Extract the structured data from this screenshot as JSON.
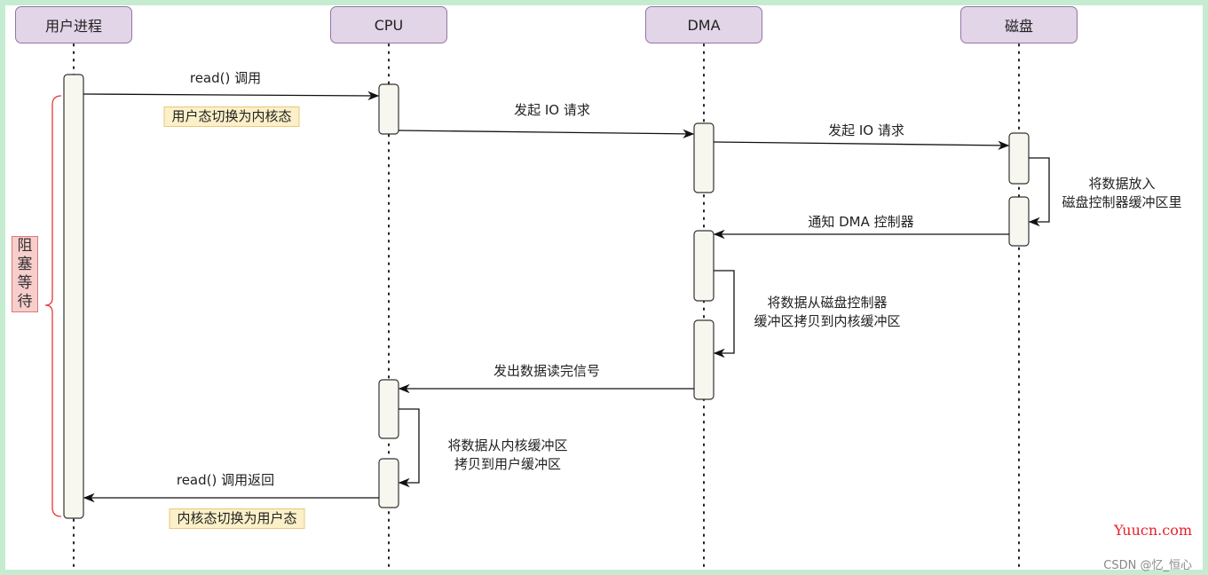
{
  "diagram": {
    "type": "sequence",
    "participants": [
      {
        "id": "user",
        "label": "用户进程"
      },
      {
        "id": "cpu",
        "label": "CPU"
      },
      {
        "id": "dma",
        "label": "DMA"
      },
      {
        "id": "disk",
        "label": "磁盘"
      }
    ],
    "messages": [
      {
        "from": "user",
        "to": "cpu",
        "label": "read() 调用",
        "note": "用户态切换为内核态"
      },
      {
        "from": "cpu",
        "to": "dma",
        "label": "发起 IO 请求"
      },
      {
        "from": "dma",
        "to": "disk",
        "label": "发起 IO 请求"
      },
      {
        "from": "disk",
        "to": "disk",
        "label_lines": [
          "将数据放入",
          "磁盘控制器缓冲区里"
        ]
      },
      {
        "from": "disk",
        "to": "dma",
        "label": "通知 DMA 控制器"
      },
      {
        "from": "dma",
        "to": "dma",
        "label_lines": [
          "将数据从磁盘控制器",
          "缓冲区拷贝到内核缓冲区"
        ]
      },
      {
        "from": "dma",
        "to": "cpu",
        "label": "发出数据读完信号"
      },
      {
        "from": "cpu",
        "to": "cpu",
        "label_lines": [
          "将数据从内核缓冲区",
          "拷贝到用户缓冲区"
        ]
      },
      {
        "from": "cpu",
        "to": "user",
        "label": "read() 调用返回",
        "note": "内核态切换为用户态"
      }
    ],
    "blocking_label": [
      "阻",
      "塞",
      "等",
      "待"
    ],
    "colors": {
      "header_fill": "#e1d5e7",
      "header_stroke": "#9673a6",
      "activation_fill": "#f8f7ef",
      "note_fill": "#fbf0c8",
      "block_fill": "#f8cecc",
      "brace": "#e53935",
      "frame": "#c5ecd0"
    }
  },
  "watermark": {
    "site": "Yuucn.com",
    "author": "CSDN @忆_恒心"
  }
}
